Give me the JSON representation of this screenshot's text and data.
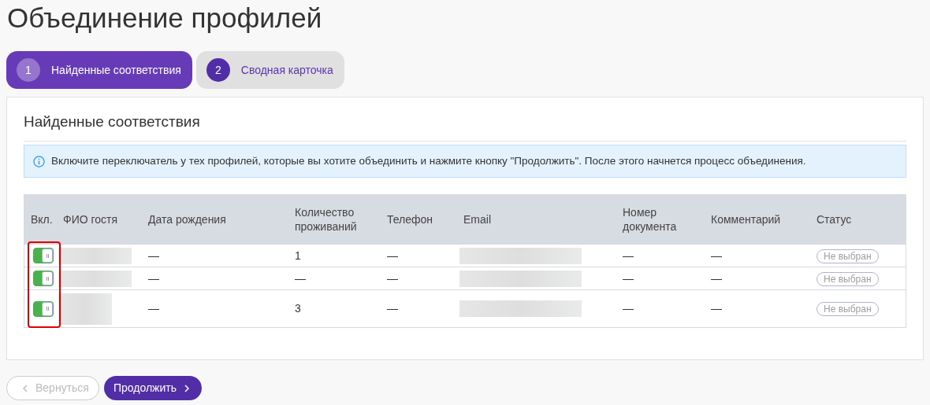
{
  "title": "Объединение профилей",
  "steps": [
    {
      "number": "1",
      "label": "Найденные соответствия",
      "selected": true
    },
    {
      "number": "2",
      "label": "Сводная карточка",
      "selected": false
    }
  ],
  "card": {
    "title": "Найденные соответствия",
    "info": "Включите переключатель у тех профилей, которые вы хотите объединить и нажмите кнопку \"Продолжить\". После этого начнется процесс объединения.",
    "toggles_highlighted": true,
    "table": {
      "columns": [
        "Вкл.",
        "ФИО гостя",
        "Дата рождения",
        "Количество проживаний",
        "Телефон",
        "Email",
        "Номер документа",
        "Комментарий",
        "Статус"
      ],
      "rows": [
        {
          "on": true,
          "name": {
            "kind": "redacted_line"
          },
          "birth_date": "—",
          "stays": "1",
          "phone": "—",
          "email": {
            "kind": "redacted_line"
          },
          "document": "—",
          "comment": "—",
          "status": "Не выбран"
        },
        {
          "on": true,
          "name": {
            "kind": "redacted_line"
          },
          "birth_date": "—",
          "stays": "—",
          "phone": "—",
          "email": {
            "kind": "redacted_line"
          },
          "document": "—",
          "comment": "—",
          "status": "Не выбран"
        },
        {
          "on": true,
          "name": {
            "kind": "redacted_block"
          },
          "birth_date": "—",
          "stays": "3",
          "phone": "—",
          "email": {
            "kind": "redacted_line"
          },
          "document": "—",
          "comment": "—",
          "status": "Не выбран"
        }
      ]
    }
  },
  "buttons": {
    "back": {
      "label": "Вернуться",
      "disabled": true
    },
    "next": {
      "label": "Продолжить",
      "disabled": false
    }
  }
}
